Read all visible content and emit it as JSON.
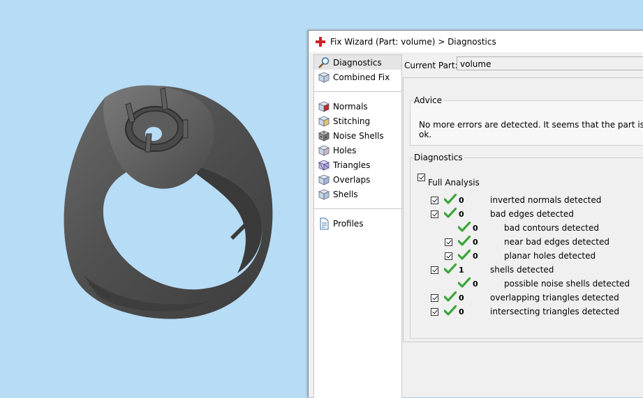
{
  "window": {
    "title": "Fix Wizard (Part: volume) > Diagnostics"
  },
  "nav": {
    "items": [
      {
        "label": "Diagnostics",
        "icon": "magnifier-icon",
        "selected": true
      },
      {
        "label": "Combined Fix",
        "icon": "cubes-icon",
        "selected": false
      },
      {
        "label": "Normals",
        "icon": "normals-cube-icon",
        "selected": false
      },
      {
        "label": "Stitching",
        "icon": "stitching-cube-icon",
        "selected": false
      },
      {
        "label": "Noise Shells",
        "icon": "noise-shells-cube-icon",
        "selected": false
      },
      {
        "label": "Holes",
        "icon": "holes-cube-icon",
        "selected": false
      },
      {
        "label": "Triangles",
        "icon": "triangles-cube-icon",
        "selected": false
      },
      {
        "label": "Overlaps",
        "icon": "overlaps-cube-icon",
        "selected": false
      },
      {
        "label": "Shells",
        "icon": "shells-cube-icon",
        "selected": false
      },
      {
        "label": "Profiles",
        "icon": "document-icon",
        "selected": false
      }
    ]
  },
  "current_part": {
    "label": "Current Part:",
    "value": "volume"
  },
  "advice": {
    "title": "Advice",
    "text": "No more errors are detected. It seems that the part is ok."
  },
  "diagnostics": {
    "title": "Diagnostics",
    "full_analysis_label": "Full Analysis",
    "full_analysis_checked": true,
    "rows": [
      {
        "checkbox": true,
        "count": "0",
        "label": "inverted normals detected",
        "indent": 0
      },
      {
        "checkbox": true,
        "count": "0",
        "label": "bad edges detected",
        "indent": 0
      },
      {
        "checkbox": false,
        "count": "0",
        "label": "bad contours detected",
        "indent": 1
      },
      {
        "checkbox": true,
        "count": "0",
        "label": "near bad edges detected",
        "indent": 1
      },
      {
        "checkbox": true,
        "count": "0",
        "label": "planar holes detected",
        "indent": 1
      },
      {
        "checkbox": true,
        "count": "1",
        "label": "shells detected",
        "indent": 0
      },
      {
        "checkbox": false,
        "count": "0",
        "label": "possible noise shells detected",
        "indent": 1
      },
      {
        "checkbox": true,
        "count": "0",
        "label": "overlapping triangles detected",
        "indent": 0
      },
      {
        "checkbox": true,
        "count": "0",
        "label": "intersecting triangles detected",
        "indent": 0
      }
    ]
  },
  "colors": {
    "viewport_background": "#b7dcf5",
    "ok_green": "#3aa63a",
    "model_gray": "#555555"
  }
}
